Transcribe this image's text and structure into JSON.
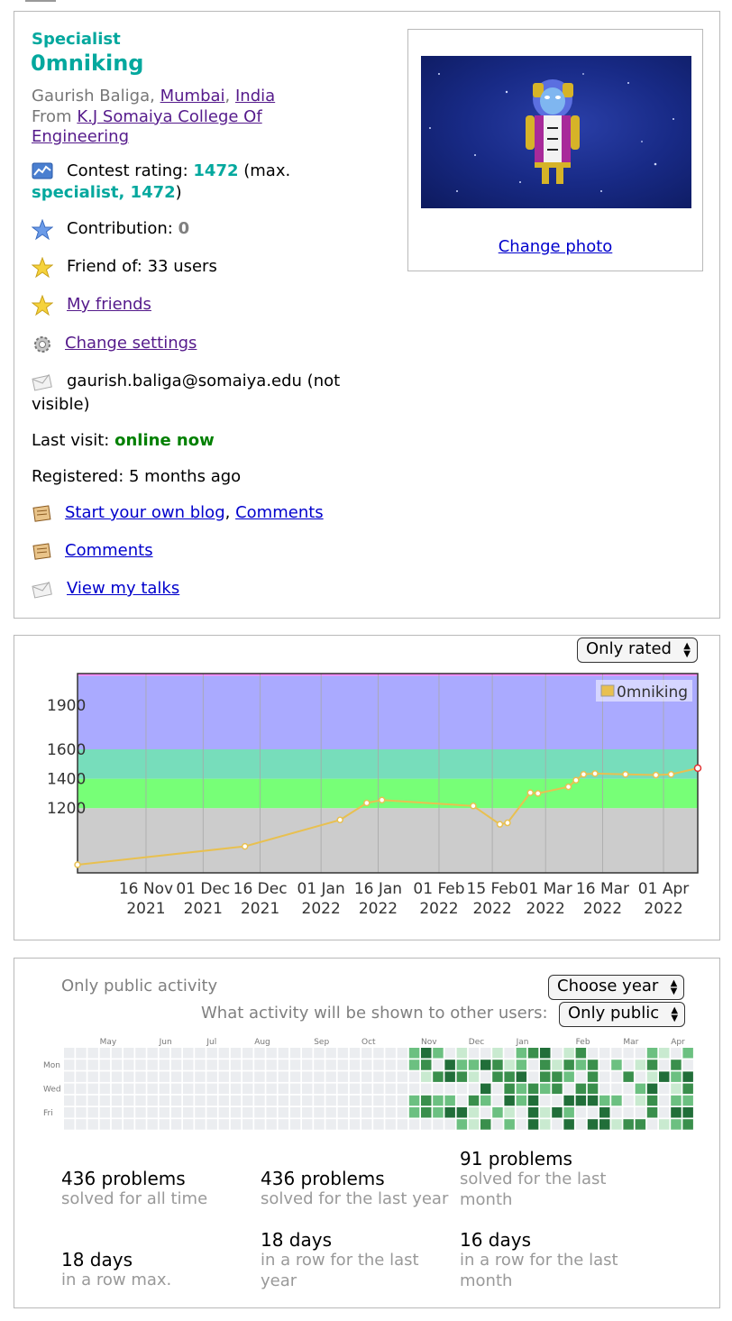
{
  "profile": {
    "rank": "Specialist",
    "handle": "0mniking",
    "name": "Gaurish Baliga",
    "city": "Mumbai",
    "country": "India",
    "from_label": "From",
    "organization": "K.J Somaiya College Of Engineering",
    "rating_label": "Contest rating:",
    "rating": "1472",
    "max_open": "(max.",
    "max_rank": "specialist, 1472",
    "max_close": ")",
    "contribution_label": "Contribution:",
    "contribution": "0",
    "friend_of": "Friend of: 33 users",
    "my_friends": "My friends",
    "change_settings": "Change settings",
    "email_line1": "gaurish.baliga@somaiya.edu (not",
    "email_line2": "visible)",
    "last_visit_label": "Last visit:",
    "last_visit": "online now",
    "registered": "Registered: 5 months ago",
    "blog": "Start your own blog",
    "comma": ",",
    "comments_inline": "Comments",
    "comments": "Comments",
    "talks": "View my talks",
    "change_photo": "Change photo"
  },
  "rating_filter": "Only rated",
  "chart_data": {
    "type": "line",
    "series": [
      {
        "name": "0mniking",
        "points": [
          [
            "2021-10-29",
            815
          ],
          [
            "2021-12-12",
            940
          ],
          [
            "2022-01-06",
            1120
          ],
          [
            "2022-01-13",
            1235
          ],
          [
            "2022-01-17",
            1255
          ],
          [
            "2022-02-10",
            1215
          ],
          [
            "2022-02-17",
            1090
          ],
          [
            "2022-02-19",
            1100
          ],
          [
            "2022-02-25",
            1305
          ],
          [
            "2022-02-27",
            1300
          ],
          [
            "2022-03-07",
            1345
          ],
          [
            "2022-03-09",
            1390
          ],
          [
            "2022-03-11",
            1430
          ],
          [
            "2022-03-14",
            1435
          ],
          [
            "2022-03-22",
            1430
          ],
          [
            "2022-03-30",
            1425
          ],
          [
            "2022-04-03",
            1430
          ],
          [
            "2022-04-10",
            1472
          ]
        ]
      }
    ],
    "y_ticks": [
      "1900",
      "1600",
      "1400",
      "1200"
    ],
    "x_ticks": [
      {
        "date": "2021-11-16",
        "l1": "16 Nov",
        "l2": "2021"
      },
      {
        "date": "2021-12-01",
        "l1": "01 Dec",
        "l2": "2021"
      },
      {
        "date": "2021-12-16",
        "l1": "16 Dec",
        "l2": "2021"
      },
      {
        "date": "2022-01-01",
        "l1": "01 Jan",
        "l2": "2022"
      },
      {
        "date": "2022-01-16",
        "l1": "16 Jan",
        "l2": "2022"
      },
      {
        "date": "2022-02-01",
        "l1": "01 Feb",
        "l2": "2022"
      },
      {
        "date": "2022-02-15",
        "l1": "15 Feb",
        "l2": "2022"
      },
      {
        "date": "2022-03-01",
        "l1": "01 Mar",
        "l2": "2022"
      },
      {
        "date": "2022-03-16",
        "l1": "16 Mar",
        "l2": "2022"
      },
      {
        "date": "2022-04-01",
        "l1": "01 Apr",
        "l2": "2022"
      }
    ],
    "x_range": [
      "2021-10-29",
      "2022-04-10"
    ],
    "y_range": [
      760,
      2115
    ],
    "bands": [
      {
        "from": 760,
        "to": 1200,
        "color": "#cccccc"
      },
      {
        "from": 1200,
        "to": 1400,
        "color": "#77ff77"
      },
      {
        "from": 1400,
        "to": 1600,
        "color": "#77ddbb"
      },
      {
        "from": 1600,
        "to": 2100,
        "color": "#aaaaff"
      },
      {
        "from": 2100,
        "to": 2115,
        "color": "#ff88ff"
      }
    ],
    "line_color": "#e8c050",
    "legend": "top-right",
    "grid": true
  },
  "activity": {
    "only_public": "Only public activity",
    "choose_year": "Choose year",
    "what_label": "What activity will be shown to other users:",
    "visibility": "Only public",
    "months": [
      "May",
      "Jun",
      "Jul",
      "Aug",
      "Sep",
      "Oct",
      "Nov",
      "Dec",
      "Jan",
      "Feb",
      "Mar",
      "Apr"
    ],
    "days": [
      "Mon",
      "Wed",
      "Fri"
    ],
    "stats": [
      {
        "big": "436 problems",
        "small": "solved for all time"
      },
      {
        "big": "436 problems",
        "small": "solved for the last year"
      },
      {
        "big": "91 problems",
        "small": "solved for the last month"
      },
      {
        "big": "18 days",
        "small": "in a row max."
      },
      {
        "big": "18 days",
        "small": "in a row for the last year"
      },
      {
        "big": "16 days",
        "small": "in a row for the last month"
      }
    ]
  }
}
